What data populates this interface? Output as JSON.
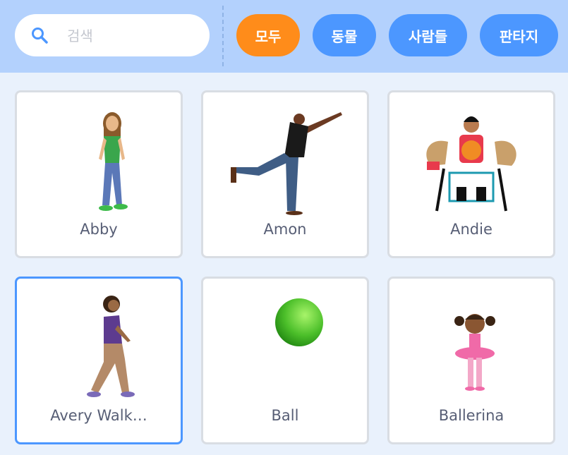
{
  "search": {
    "placeholder": "검색",
    "value": "",
    "icon": "search-icon"
  },
  "filters": [
    {
      "label": "모두",
      "active": true
    },
    {
      "label": "동물",
      "active": false
    },
    {
      "label": "사람들",
      "active": false
    },
    {
      "label": "판타지",
      "active": false
    }
  ],
  "sprites": [
    {
      "name": "Abby",
      "selected": false
    },
    {
      "name": "Amon",
      "selected": false
    },
    {
      "name": "Andie",
      "selected": false
    },
    {
      "name": "Avery Walk…",
      "selected": true
    },
    {
      "name": "Ball",
      "selected": false
    },
    {
      "name": "Ballerina",
      "selected": false
    }
  ],
  "colors": {
    "header_bg": "#b3d1fd",
    "page_bg": "#e9f1fc",
    "accent_blue": "#4c97ff",
    "accent_orange": "#ff8c1a",
    "card_text": "#575e75"
  }
}
